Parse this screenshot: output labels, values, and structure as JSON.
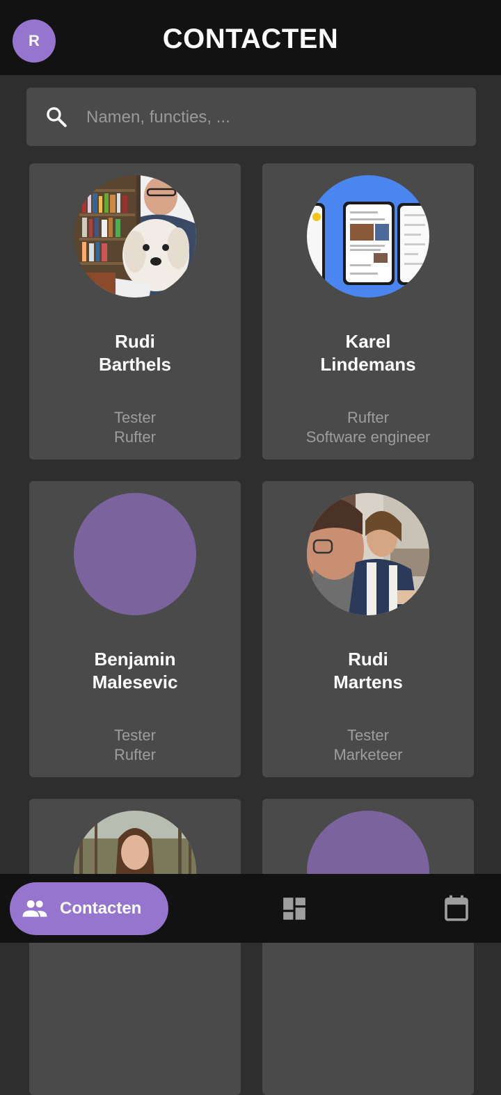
{
  "header": {
    "avatar_initial": "R",
    "title": "CONTACTEN"
  },
  "search": {
    "placeholder": "Namen, functies, ..."
  },
  "contacts": [
    {
      "first": "Rudi",
      "last": "Barthels",
      "line1": "Tester",
      "line2": "Rufter",
      "avatar": "photo-man-with-dog"
    },
    {
      "first": "Karel",
      "last": "Lindemans",
      "line1": "Rufter",
      "line2": "Software engineer",
      "avatar": "photo-app-screens"
    },
    {
      "first": "Benjamin",
      "last": "Malesevic",
      "line1": "Tester",
      "line2": "Rufter",
      "avatar": "placeholder-circle"
    },
    {
      "first": "Rudi",
      "last": "Martens",
      "line1": "Tester",
      "line2": "Marketeer",
      "avatar": "photo-two-men"
    },
    {
      "avatar": "photo-woman-outdoors"
    },
    {
      "avatar": "placeholder-circle"
    }
  ],
  "bottom_nav": {
    "active_label": "Contacten",
    "items": [
      "people-icon",
      "dashboard-icon",
      "calendar-icon"
    ]
  },
  "colors": {
    "accent": "#9575cd",
    "background": "#2e2e2e",
    "card": "#4a4a4a",
    "bar": "#121212"
  }
}
